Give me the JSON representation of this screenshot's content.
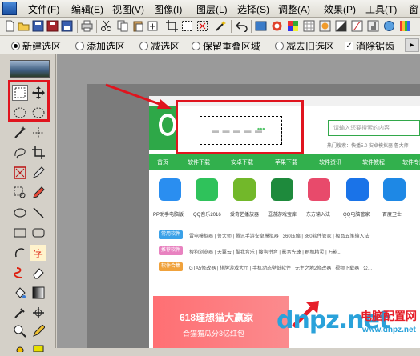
{
  "menubar": {
    "items": [
      "文件(F)",
      "编辑(E)",
      "视图(V)",
      "图像(I)",
      "图层(L)",
      "选择(S)",
      "调整(A)",
      "效果(P)",
      "工具(T)",
      "窗"
    ]
  },
  "toolbar": {
    "icons": [
      "new-icon",
      "open-icon",
      "save-icon",
      "save-as-icon",
      "print-icon",
      "cut-icon",
      "copy-icon",
      "paste-icon",
      "paste-new-icon",
      "crop-icon",
      "deselect-icon",
      "select-all-icon",
      "magic-icon",
      "undo-icon",
      "color-icon",
      "palette-icon"
    ]
  },
  "options": {
    "new_selection": "新建选区",
    "add_selection": "添加选区",
    "subtract_selection": "减选区",
    "intersect_selection": "保留重叠区域",
    "xor_selection": "减去旧选区",
    "antialias": "消除锯齿"
  },
  "tools": {
    "text_tool": "字",
    "names": [
      "rect-select",
      "move",
      "lasso",
      "ellipse-select",
      "magic-wand",
      "move-selection",
      "crop",
      "zoom-pen",
      "paint-bucket",
      "pencil",
      "ellipse",
      "line",
      "rectangle",
      "rounded-rect",
      "freeform",
      "text",
      "recolor",
      "eraser",
      "fill",
      "gradient",
      "color-picker",
      "clone",
      "zoom",
      "pencil-2",
      "brush",
      "color-swap"
    ]
  },
  "website": {
    "search_placeholder": "请输入您要搜索的内容",
    "hot_searches": "热门搜索：快播5.0  安卓模拟器  鲁大师",
    "nav": [
      "首页",
      "软件下载",
      "安卓下载",
      "苹果下载",
      "软件资讯",
      "软件教程",
      "软件专题"
    ],
    "apps": [
      {
        "label": "PP助手电脑版",
        "color": "#2a8ef0"
      },
      {
        "label": "QQ音乐2016",
        "color": "#2fc25b"
      },
      {
        "label": "爱奇艺播放器",
        "color": "#72b82a"
      },
      {
        "label": "逗游游戏宝库",
        "color": "#1e8a3c"
      },
      {
        "label": "东方输入法",
        "color": "#e84a6b"
      },
      {
        "label": "QQ电脑管家",
        "color": "#1a73e8"
      },
      {
        "label": "百度卫士",
        "color": "#1e88e5"
      }
    ],
    "rows": [
      {
        "tag": "常用软件",
        "color": "#3aa1e8",
        "text": "雷电模拟器 | 鲁大师 | 腾讯手游安卓模拟器 | 360压缩 | 360软件管家 | 极品五笔输入法"
      },
      {
        "tag": "推荐软件",
        "color": "#e882c0",
        "text": "搜狗浏览器 | 天翼云 | 酷我音乐 | 搜狗拼音 | 影音先锋 | 刷机精灵 | 万能..."
      },
      {
        "tag": "软件合集",
        "color": "#f0a23c",
        "text": "GTA5修改器 | 棋牌游戏大厅 | 手机动态壁纸软件 | 无主之地2修改器 | 视频下载器 | 公..."
      }
    ],
    "banner_title": "618理想猫大赢家",
    "banner_sub": "合猫猫瓜分3亿红包"
  },
  "watermark": {
    "main": "dnpz.net",
    "cn": "电脑配置网",
    "url": "www.dnpz.net"
  },
  "colors": {
    "highlight": "#e0141e",
    "site_green": "#32b04d",
    "watermark_blue": "#2aa2da"
  }
}
